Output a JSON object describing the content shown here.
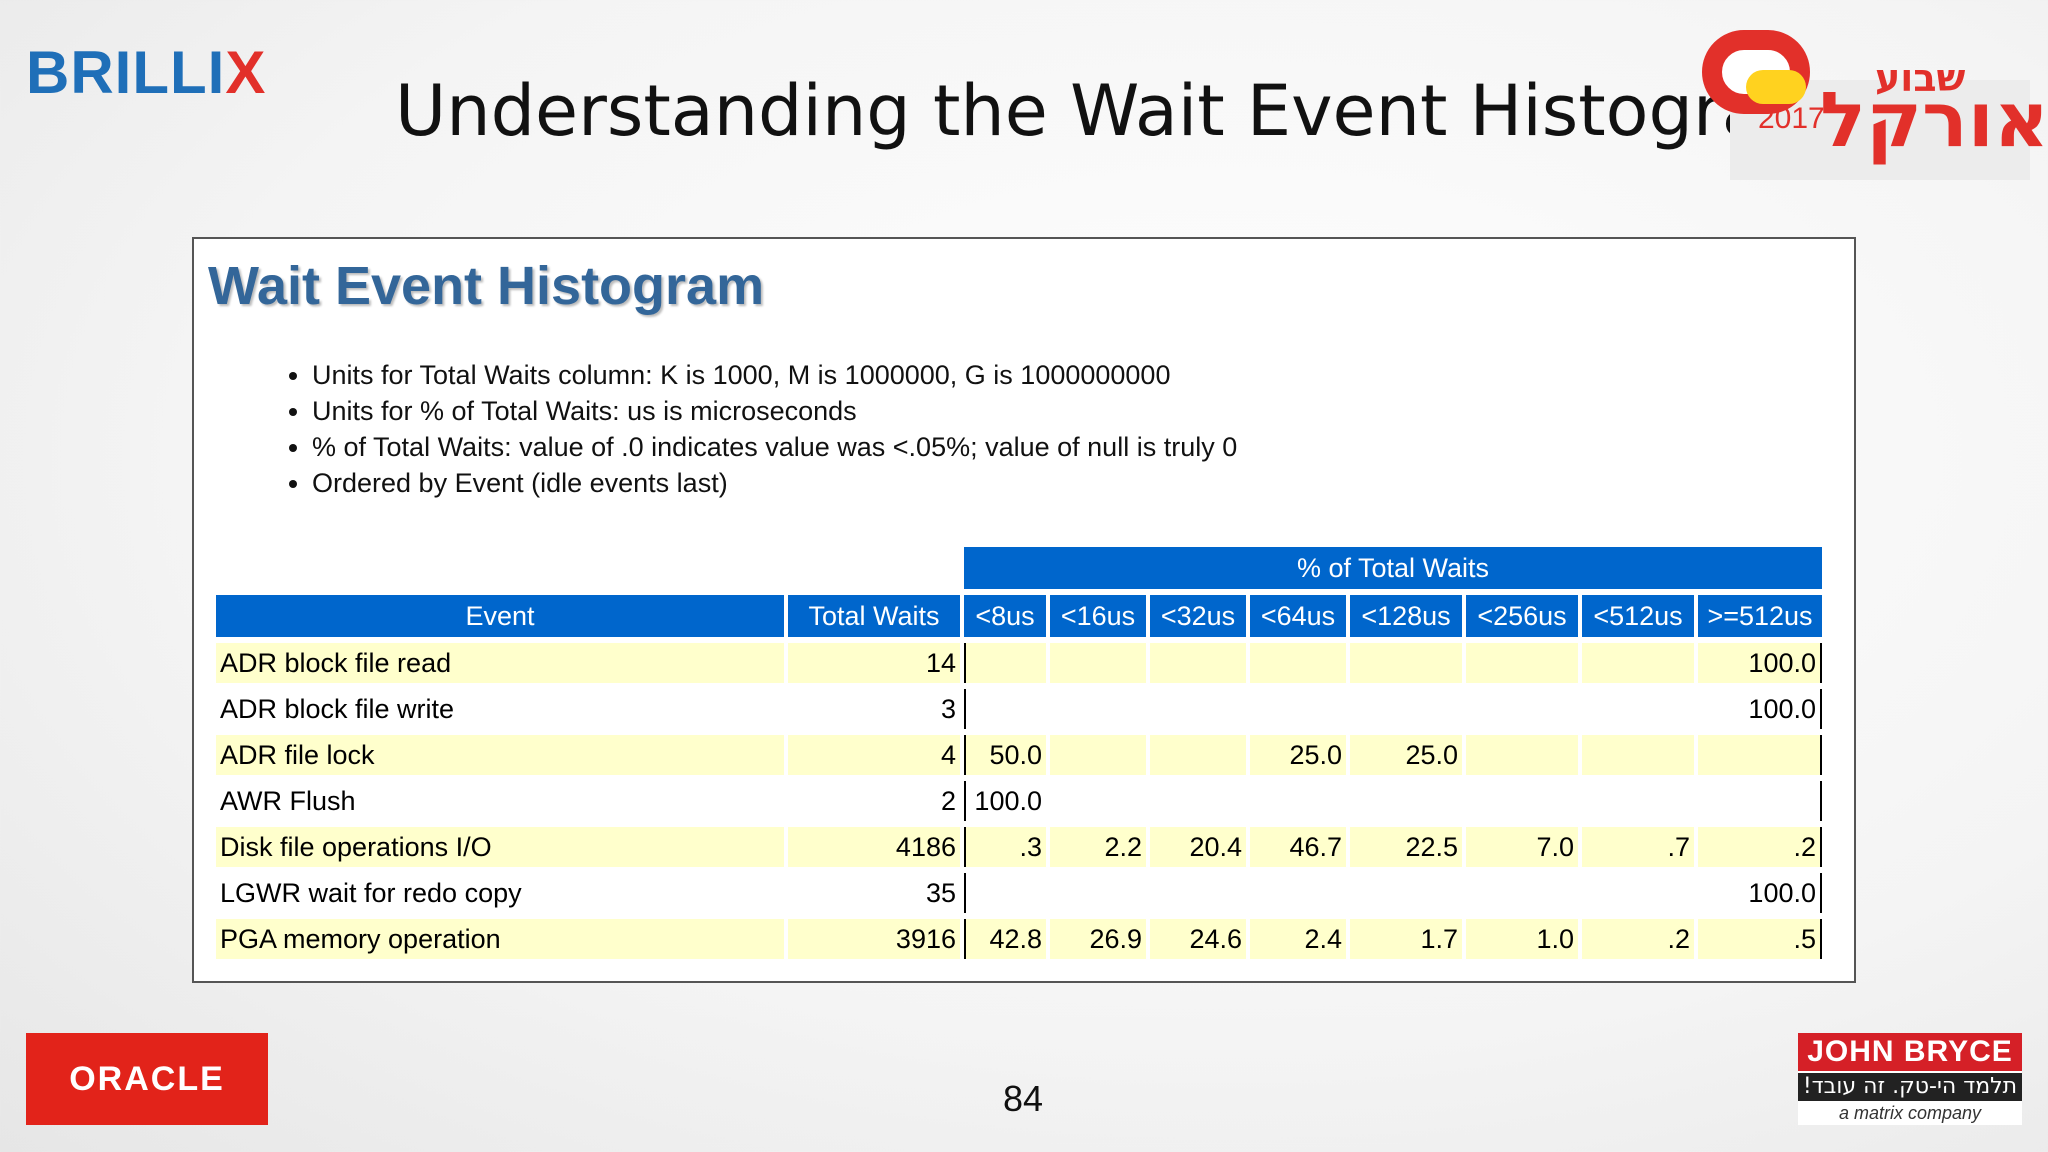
{
  "slide": {
    "title": "Understanding the Wait Event Histogram",
    "page_number": "84"
  },
  "logos": {
    "brillix_main": "BRILLI",
    "brillix_x": "X",
    "oracle": "ORACLE",
    "oracle_week_year": "2017",
    "oracle_week_hebrew_top": "שבוע",
    "oracle_week_hebrew_main": "אורקל",
    "john_bryce": "JOHN BRYCE",
    "john_bryce_slogan": "תלמד הי-טק. זה עובד!",
    "john_bryce_tagline": "a matrix company"
  },
  "report": {
    "heading": "Wait Event Histogram",
    "notes": [
      "Units for Total Waits column: K is 1000, M is 1000000, G is 1000000000",
      "Units for % of Total Waits: us is microseconds",
      "% of Total Waits: value of .0 indicates value was <.05%; value of null is truly 0",
      "Ordered by Event (idle events last)"
    ],
    "group_header": "% of Total Waits",
    "columns": [
      "Event",
      "Total Waits",
      "<8us",
      "<16us",
      "<32us",
      "<64us",
      "<128us",
      "<256us",
      "<512us",
      ">=512us"
    ],
    "rows": [
      [
        "ADR block file read",
        "14",
        "",
        "",
        "",
        "",
        "",
        "",
        "",
        "100.0"
      ],
      [
        "ADR block file write",
        "3",
        "",
        "",
        "",
        "",
        "",
        "",
        "",
        "100.0"
      ],
      [
        "ADR file lock",
        "4",
        "50.0",
        "",
        "",
        "25.0",
        "25.0",
        "",
        "",
        ""
      ],
      [
        "AWR Flush",
        "2",
        "100.0",
        "",
        "",
        "",
        "",
        "",
        "",
        ""
      ],
      [
        "Disk file operations I/O",
        "4186",
        ".3",
        "2.2",
        "20.4",
        "46.7",
        "22.5",
        "7.0",
        ".7",
        ".2"
      ],
      [
        "LGWR wait for redo copy",
        "35",
        "",
        "",
        "",
        "",
        "",
        "",
        "",
        "100.0"
      ],
      [
        "PGA memory operation",
        "3916",
        "42.8",
        "26.9",
        "24.6",
        "2.4",
        "1.7",
        "1.0",
        ".2",
        ".5"
      ]
    ]
  }
}
